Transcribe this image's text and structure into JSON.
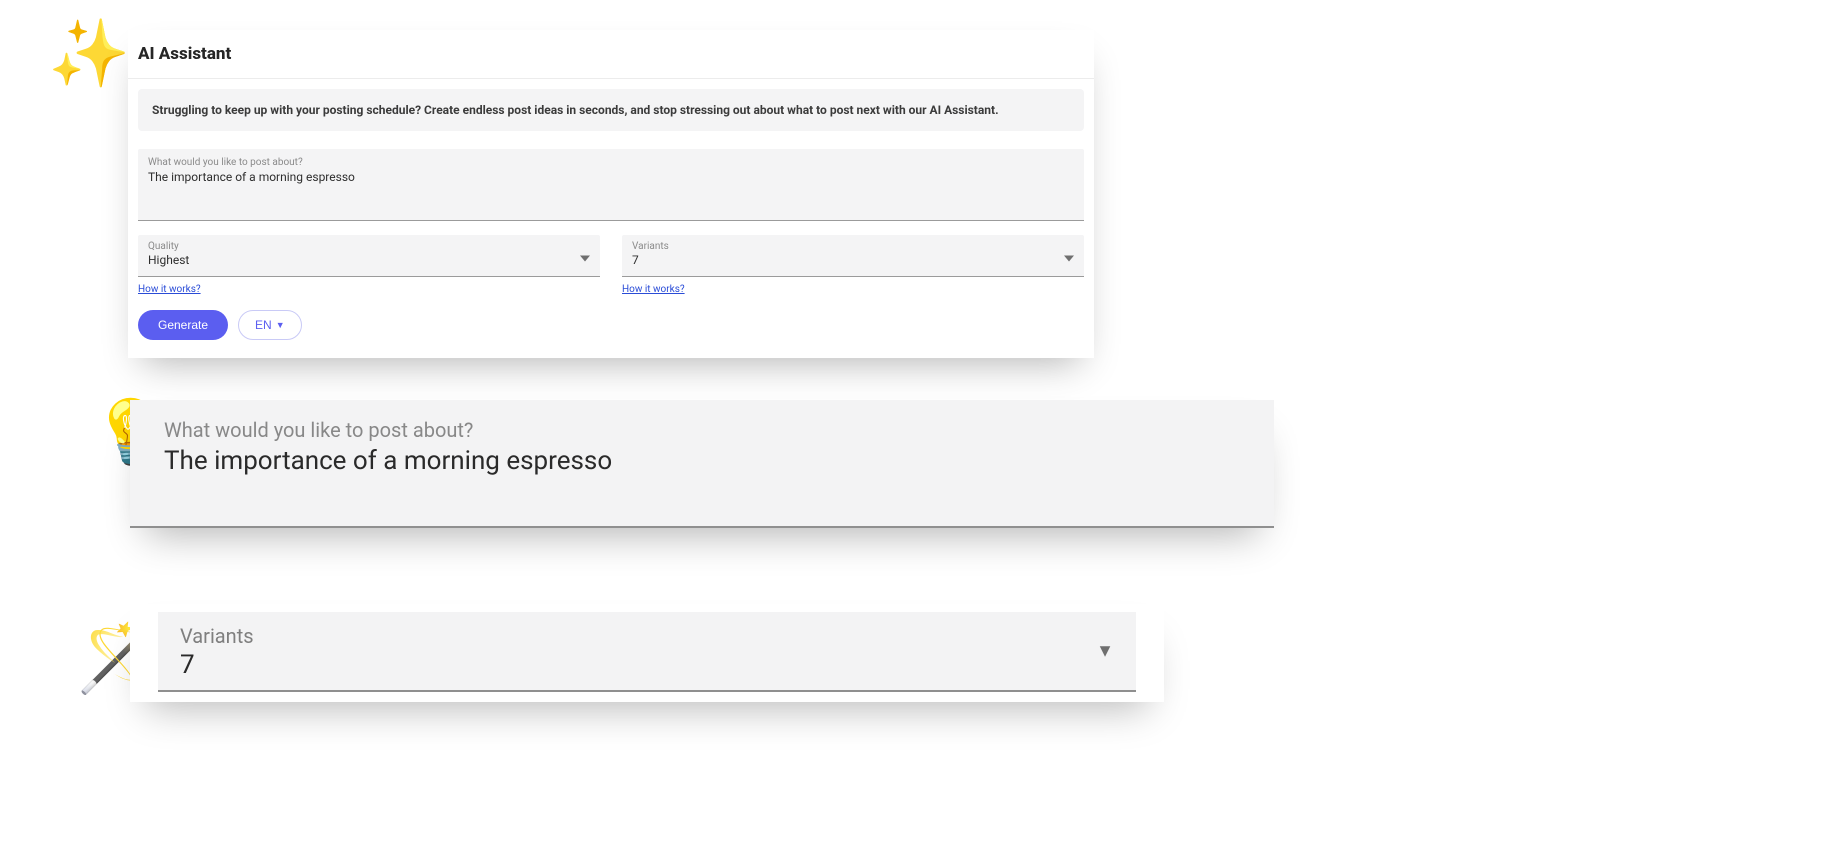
{
  "header": {
    "title": "AI Assistant"
  },
  "banner": {
    "text": "Struggling to keep up with your posting schedule? Create endless post ideas in seconds, and stop stressing out about what to post next with our AI Assistant."
  },
  "postField": {
    "label": "What would you like to post about?",
    "value": "The importance of a morning espresso"
  },
  "quality": {
    "label": "Quality",
    "value": "Highest",
    "helpText": "How it works?"
  },
  "variants": {
    "label": "Variants",
    "value": "7",
    "helpText": "How it works?"
  },
  "actions": {
    "generateLabel": "Generate",
    "langLabel": "EN"
  },
  "zoomPost": {
    "label": "What would you like to post about?",
    "value": "The importance of a morning espresso"
  },
  "zoomVariant": {
    "label": "Variants",
    "value": "7"
  },
  "icons": {
    "sparkles": "sparkles-icon",
    "bulb": "lightbulb-icon",
    "wand": "magic-wand-icon"
  }
}
